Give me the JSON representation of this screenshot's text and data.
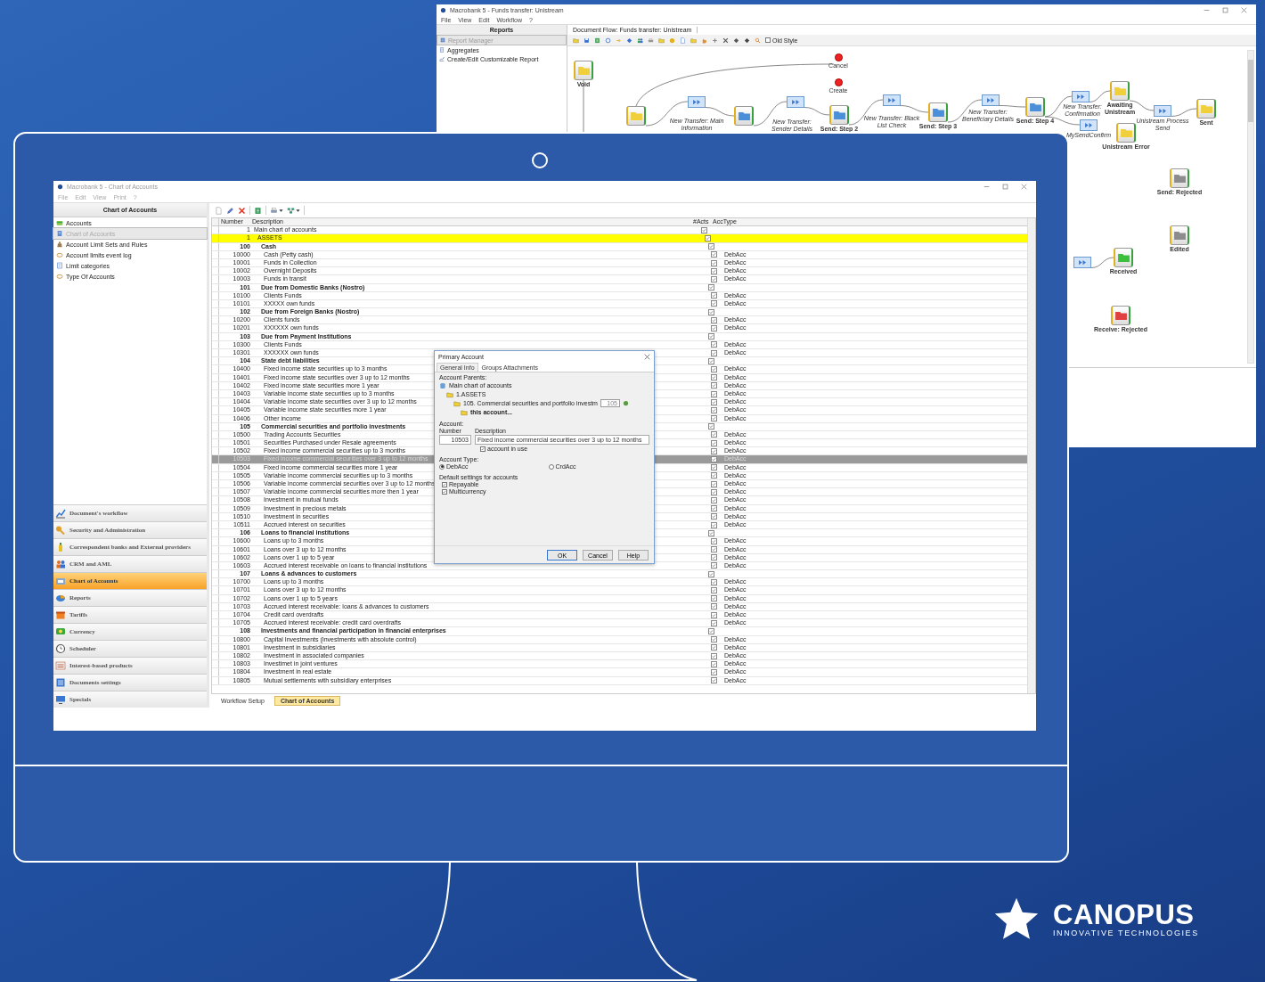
{
  "workflow_window": {
    "title": "Macrobank 5 - Funds transfer: Unistream",
    "menu": [
      "File",
      "View",
      "Edit",
      "Workflow",
      "?"
    ],
    "panel_title": "Reports",
    "panel_items": [
      {
        "label": "Report Manager",
        "selected": true
      },
      {
        "label": "Aggregates",
        "selected": false
      },
      {
        "label": "Create/Edit Customizable Report",
        "selected": false
      }
    ],
    "tab": "Document Flow: Funds transfer: Unistream",
    "old_style": {
      "label": "Old Style",
      "checked": false
    },
    "nodes": [
      {
        "kind": "state",
        "color": "#efcf3a",
        "label": "Void"
      },
      {
        "kind": "action",
        "label": "Cancel"
      },
      {
        "kind": "action",
        "label": "Create"
      },
      {
        "kind": "state",
        "color": "#efcf3a"
      },
      {
        "kind": "transition",
        "label": "New Transfer: Main Information"
      },
      {
        "kind": "state",
        "color": "#4a8fd8"
      },
      {
        "kind": "transition",
        "label": "New Transfer: Sender Details"
      },
      {
        "kind": "state",
        "color": "#4a8fd8",
        "label": "Send: Step 2"
      },
      {
        "kind": "transition",
        "label": "New Transfer: Black List Check"
      },
      {
        "kind": "state",
        "color": "#4a8fd8",
        "label": "Send: Step 3"
      },
      {
        "kind": "transition",
        "label": "New Transfer: Beneficiary Details"
      },
      {
        "kind": "state",
        "color": "#4a8fd8",
        "label": "Send: Step 4"
      },
      {
        "kind": "transition",
        "label": "New Transfer: Confirmation"
      },
      {
        "kind": "state",
        "color": "#efcf3a",
        "label": "Awaiting Unistream"
      },
      {
        "kind": "transition",
        "label": "Unistream Process Send"
      },
      {
        "kind": "state",
        "color": "#efcf3a",
        "label": "Sent"
      },
      {
        "kind": "transition",
        "label": "MySendConfirm"
      },
      {
        "kind": "state",
        "color": "#efcf3a",
        "label": "Unistream Error"
      },
      {
        "kind": "state",
        "color": "#8c8c8c",
        "label": "Send: Rejected"
      },
      {
        "kind": "state",
        "color": "#8c8c8c",
        "label": "Edited"
      },
      {
        "kind": "transition"
      },
      {
        "kind": "state",
        "color": "#3cbf3c",
        "label": "Received"
      },
      {
        "kind": "state",
        "color": "#e04040",
        "label": "Receive: Rejected"
      }
    ]
  },
  "app_window": {
    "title": "Macrobank 5 - Chart of Accounts",
    "menu": [
      "File",
      "Edit",
      "View",
      "Print",
      "?"
    ],
    "sidebar": {
      "title": "Chart of Accounts",
      "items": [
        {
          "label": "Accounts",
          "selected": false
        },
        {
          "label": "Chart of Accounts",
          "selected": true
        },
        {
          "label": "Account Limit Sets and Rules",
          "selected": false
        },
        {
          "label": "Account limits event log",
          "selected": false
        },
        {
          "label": "Limit categories",
          "selected": false
        },
        {
          "label": "Type Of Accounts",
          "selected": false
        }
      ],
      "modules": [
        {
          "label": "Document's workflow",
          "selected": false
        },
        {
          "label": "Security and Administration",
          "selected": false
        },
        {
          "label": "Correspondent banks and External providers",
          "selected": false
        },
        {
          "label": "CRM and AML",
          "selected": false
        },
        {
          "label": "Chart of Accounts",
          "selected": true
        },
        {
          "label": "Reports",
          "selected": false
        },
        {
          "label": "Tariffs",
          "selected": false
        },
        {
          "label": "Currency",
          "selected": false
        },
        {
          "label": "Scheduler",
          "selected": false
        },
        {
          "label": "Interest-based products",
          "selected": false
        },
        {
          "label": "Documents settings",
          "selected": false
        },
        {
          "label": "Specials",
          "selected": false
        }
      ]
    },
    "table": {
      "columns": [
        "Number",
        "Description",
        "#Acts",
        "AccType"
      ],
      "rows": [
        {
          "number": "1",
          "description": "Main chart of accounts",
          "in_use": true,
          "selected": false,
          "highlighted": false,
          "children": [
            {
              "number": "1",
              "description": "ASSETS",
              "in_use": true,
              "selected": false,
              "highlighted": true,
              "children": [
                {
                  "number": "100",
                  "description": "Cash",
                  "in_use": true,
                  "selected": false,
                  "highlighted": false,
                  "children": [
                    {
                      "number": "10000",
                      "description": "Cash (Petty  cash)",
                      "in_use": true,
                      "type": "DebAcc",
                      "selected": false,
                      "highlighted": false
                    },
                    {
                      "number": "10001",
                      "description": "Funds in Collection",
                      "in_use": true,
                      "type": "DebAcc",
                      "selected": false,
                      "highlighted": false
                    },
                    {
                      "number": "10002",
                      "description": "Overnight Deposits",
                      "in_use": true,
                      "type": "DebAcc",
                      "selected": false,
                      "highlighted": false
                    },
                    {
                      "number": "10003",
                      "description": "Funds in transit",
                      "in_use": true,
                      "type": "DebAcc",
                      "selected": false,
                      "highlighted": false
                    }
                  ]
                },
                {
                  "number": "101",
                  "description": "Due from Domestic Banks (Nostro)",
                  "in_use": true,
                  "selected": false,
                  "highlighted": false,
                  "children": [
                    {
                      "number": "10100",
                      "description": "Clients Funds",
                      "in_use": true,
                      "type": "DebAcc",
                      "selected": false,
                      "highlighted": false
                    },
                    {
                      "number": "10101",
                      "description": "XXXXX  own funds",
                      "in_use": true,
                      "type": "DebAcc",
                      "selected": false,
                      "highlighted": false
                    }
                  ]
                },
                {
                  "number": "102",
                  "description": "Due from Foreign Banks (Nostro)",
                  "in_use": true,
                  "selected": false,
                  "highlighted": false,
                  "children": [
                    {
                      "number": "10200",
                      "description": "Clients funds",
                      "in_use": true,
                      "type": "DebAcc",
                      "selected": false,
                      "highlighted": false
                    },
                    {
                      "number": "10201",
                      "description": "XXXXXX own funds",
                      "in_use": true,
                      "type": "DebAcc",
                      "selected": false,
                      "highlighted": false
                    }
                  ]
                },
                {
                  "number": "103",
                  "description": "Due from Payment Institutions",
                  "in_use": true,
                  "selected": false,
                  "highlighted": false,
                  "children": [
                    {
                      "number": "10300",
                      "description": "Clients Funds",
                      "in_use": true,
                      "type": "DebAcc",
                      "selected": false,
                      "highlighted": false
                    },
                    {
                      "number": "10301",
                      "description": "XXXXXX own funds",
                      "in_use": true,
                      "type": "DebAcc",
                      "selected": false,
                      "highlighted": false
                    }
                  ]
                },
                {
                  "number": "104",
                  "description": "State debt liabilities",
                  "in_use": true,
                  "selected": false,
                  "highlighted": false,
                  "children": [
                    {
                      "number": "10400",
                      "description": "Fixed income state securities up to 3 months",
                      "in_use": true,
                      "type": "DebAcc",
                      "selected": false,
                      "highlighted": false
                    },
                    {
                      "number": "10401",
                      "description": "Fixed income state securities over 3 up to 12 months",
                      "in_use": true,
                      "type": "DebAcc",
                      "selected": false,
                      "highlighted": false
                    },
                    {
                      "number": "10402",
                      "description": "Fixed income state securities more 1 year",
                      "in_use": true,
                      "type": "DebAcc",
                      "selected": false,
                      "highlighted": false
                    },
                    {
                      "number": "10403",
                      "description": "Variable income state securities up to 3 months",
                      "in_use": true,
                      "type": "DebAcc",
                      "selected": false,
                      "highlighted": false
                    },
                    {
                      "number": "10404",
                      "description": "Variable income state securities over 3 up to 12 months",
                      "in_use": true,
                      "type": "DebAcc",
                      "selected": false,
                      "highlighted": false
                    },
                    {
                      "number": "10405",
                      "description": "Variable income state securities more 1 year",
                      "in_use": true,
                      "type": "DebAcc",
                      "selected": false,
                      "highlighted": false
                    },
                    {
                      "number": "10406",
                      "description": "Other income",
                      "in_use": true,
                      "type": "DebAcc",
                      "selected": false,
                      "highlighted": false
                    }
                  ]
                },
                {
                  "number": "105",
                  "description": "Commercial securities and portfolio investments",
                  "in_use": true,
                  "selected": false,
                  "highlighted": false,
                  "children": [
                    {
                      "number": "10500",
                      "description": "Trading Accounts Securities",
                      "in_use": true,
                      "type": "DebAcc",
                      "selected": false,
                      "highlighted": false
                    },
                    {
                      "number": "10501",
                      "description": "Securities Purchased under Resale agreements",
                      "in_use": true,
                      "type": "DebAcc",
                      "selected": false,
                      "highlighted": false
                    },
                    {
                      "number": "10502",
                      "description": "Fixed income commercial securities up to 3 months",
                      "in_use": true,
                      "type": "DebAcc",
                      "selected": false,
                      "highlighted": false
                    },
                    {
                      "number": "10503",
                      "description": "Fixed income commercial securities over 3 up to 12 months",
                      "in_use": true,
                      "type": "DebAcc",
                      "selected": true,
                      "highlighted": false
                    },
                    {
                      "number": "10504",
                      "description": "Fixed income commercial securities more 1 year",
                      "in_use": true,
                      "type": "DebAcc",
                      "selected": false,
                      "highlighted": false
                    },
                    {
                      "number": "10505",
                      "description": "Variable income commercial securities up to 3 months",
                      "in_use": true,
                      "type": "DebAcc",
                      "selected": false,
                      "highlighted": false
                    },
                    {
                      "number": "10506",
                      "description": "Variable income commercial securities over 3 up to 12 months",
                      "in_use": true,
                      "type": "DebAcc",
                      "selected": false,
                      "highlighted": false
                    },
                    {
                      "number": "10507",
                      "description": "Variable income commercial securities more then 1 year",
                      "in_use": true,
                      "type": "DebAcc",
                      "selected": false,
                      "highlighted": false
                    },
                    {
                      "number": "10508",
                      "description": "Investment in mutual funds",
                      "in_use": true,
                      "type": "DebAcc",
                      "selected": false,
                      "highlighted": false
                    },
                    {
                      "number": "10509",
                      "description": "Investment in precious metals",
                      "in_use": true,
                      "type": "DebAcc",
                      "selected": false,
                      "highlighted": false
                    },
                    {
                      "number": "10510",
                      "description": "Investment in securities",
                      "in_use": true,
                      "type": "DebAcc",
                      "selected": false,
                      "highlighted": false
                    },
                    {
                      "number": "10511",
                      "description": "Accrued interest on securities",
                      "in_use": true,
                      "type": "DebAcc",
                      "selected": false,
                      "highlighted": false
                    }
                  ]
                },
                {
                  "number": "106",
                  "description": "Loans to financial institutions",
                  "in_use": true,
                  "selected": false,
                  "highlighted": false,
                  "children": [
                    {
                      "number": "10600",
                      "description": "Loans  up to 3 months",
                      "in_use": true,
                      "type": "DebAcc",
                      "selected": false,
                      "highlighted": false
                    },
                    {
                      "number": "10601",
                      "description": "Loans over 3 up to 12 months",
                      "in_use": true,
                      "type": "DebAcc",
                      "selected": false,
                      "highlighted": false
                    },
                    {
                      "number": "10602",
                      "description": "Loans over 1 up to 5 year",
                      "in_use": true,
                      "type": "DebAcc",
                      "selected": false,
                      "highlighted": false
                    },
                    {
                      "number": "10603",
                      "description": "Accrued interest receivable on loans to financial institutions",
                      "in_use": true,
                      "type": "DebAcc",
                      "selected": false,
                      "highlighted": false
                    }
                  ]
                },
                {
                  "number": "107",
                  "description": "Loans & advances to customers",
                  "in_use": true,
                  "selected": false,
                  "highlighted": false,
                  "children": [
                    {
                      "number": "10700",
                      "description": "Loans  up to 3 months",
                      "in_use": true,
                      "type": "DebAcc",
                      "selected": false,
                      "highlighted": false
                    },
                    {
                      "number": "10701",
                      "description": "Loans over 3 up to 12 months",
                      "in_use": true,
                      "type": "DebAcc",
                      "selected": false,
                      "highlighted": false
                    },
                    {
                      "number": "10702",
                      "description": "Loans over 1 up to 5 years",
                      "in_use": true,
                      "type": "DebAcc",
                      "selected": false,
                      "highlighted": false
                    },
                    {
                      "number": "10703",
                      "description": "Accrued interest receivable: loans & advances to customers",
                      "in_use": true,
                      "type": "DebAcc",
                      "selected": false,
                      "highlighted": false
                    },
                    {
                      "number": "10704",
                      "description": "Credit card overdrafts",
                      "in_use": true,
                      "type": "DebAcc",
                      "selected": false,
                      "highlighted": false
                    },
                    {
                      "number": "10705",
                      "description": "Accrued interest receivable: credit card overdrafts",
                      "in_use": true,
                      "type": "DebAcc",
                      "selected": false,
                      "highlighted": false
                    }
                  ]
                },
                {
                  "number": "108",
                  "description": "Investments and financial participation in financial enterprises",
                  "in_use": true,
                  "selected": false,
                  "highlighted": false,
                  "children": [
                    {
                      "number": "10800",
                      "description": "Capital Investments (Investments with absolute control)",
                      "in_use": true,
                      "type": "DebAcc",
                      "selected": false,
                      "highlighted": false
                    },
                    {
                      "number": "10801",
                      "description": "Investment in subsidiaries",
                      "in_use": true,
                      "type": "DebAcc",
                      "selected": false,
                      "highlighted": false
                    },
                    {
                      "number": "10802",
                      "description": "Investment in associated companies",
                      "in_use": true,
                      "type": "DebAcc",
                      "selected": false,
                      "highlighted": false
                    },
                    {
                      "number": "10803",
                      "description": "Investimet in joint ventures",
                      "in_use": true,
                      "type": "DebAcc",
                      "selected": false,
                      "highlighted": false
                    },
                    {
                      "number": "10804",
                      "description": "Investment in real estate",
                      "in_use": true,
                      "type": "DebAcc",
                      "selected": false,
                      "highlighted": false
                    },
                    {
                      "number": "10805",
                      "description": "Mutual settlements with subsidiary enterprises",
                      "in_use": true,
                      "type": "DebAcc",
                      "selected": false,
                      "highlighted": false
                    }
                  ]
                }
              ]
            }
          ]
        }
      ]
    },
    "bottom_tabs": [
      {
        "label": "Workflow Setup",
        "selected": false
      },
      {
        "label": "Chart of Accounts",
        "selected": true
      }
    ],
    "dialog": {
      "title": "Primary Account",
      "tabs": [
        {
          "label": "General Info",
          "selected": true
        },
        {
          "label": "Groups Attachments",
          "selected": false
        }
      ],
      "parents_label": "Account Parents:",
      "parents": [
        {
          "text": "Main chart of accounts"
        },
        {
          "text": "1.ASSETS"
        },
        {
          "text": "105.   Commercial securities and portfolio investm",
          "code": "105"
        },
        {
          "text": "this account..."
        }
      ],
      "account_label": "Account:",
      "number_label": "Number",
      "description_label": "Description",
      "number": "10503",
      "description": "Fixed income commercial securities over 3 up to 12 months",
      "in_use": {
        "label": "account in use",
        "checked": true
      },
      "type_label": "Account Type:",
      "types": [
        {
          "label": "DebAcc",
          "selected": true
        },
        {
          "label": "CrdAcc",
          "selected": false
        }
      ],
      "defaults_label": "Default settings for accounts",
      "defaults": [
        {
          "label": "Repayable",
          "checked": true
        },
        {
          "label": "Multicurrency",
          "checked": true
        }
      ],
      "buttons": [
        "OK",
        "Cancel",
        "Help"
      ]
    }
  },
  "logo": {
    "name": "CANOPUS",
    "tagline": "INNOVATIVE TECHNOLOGIES"
  }
}
